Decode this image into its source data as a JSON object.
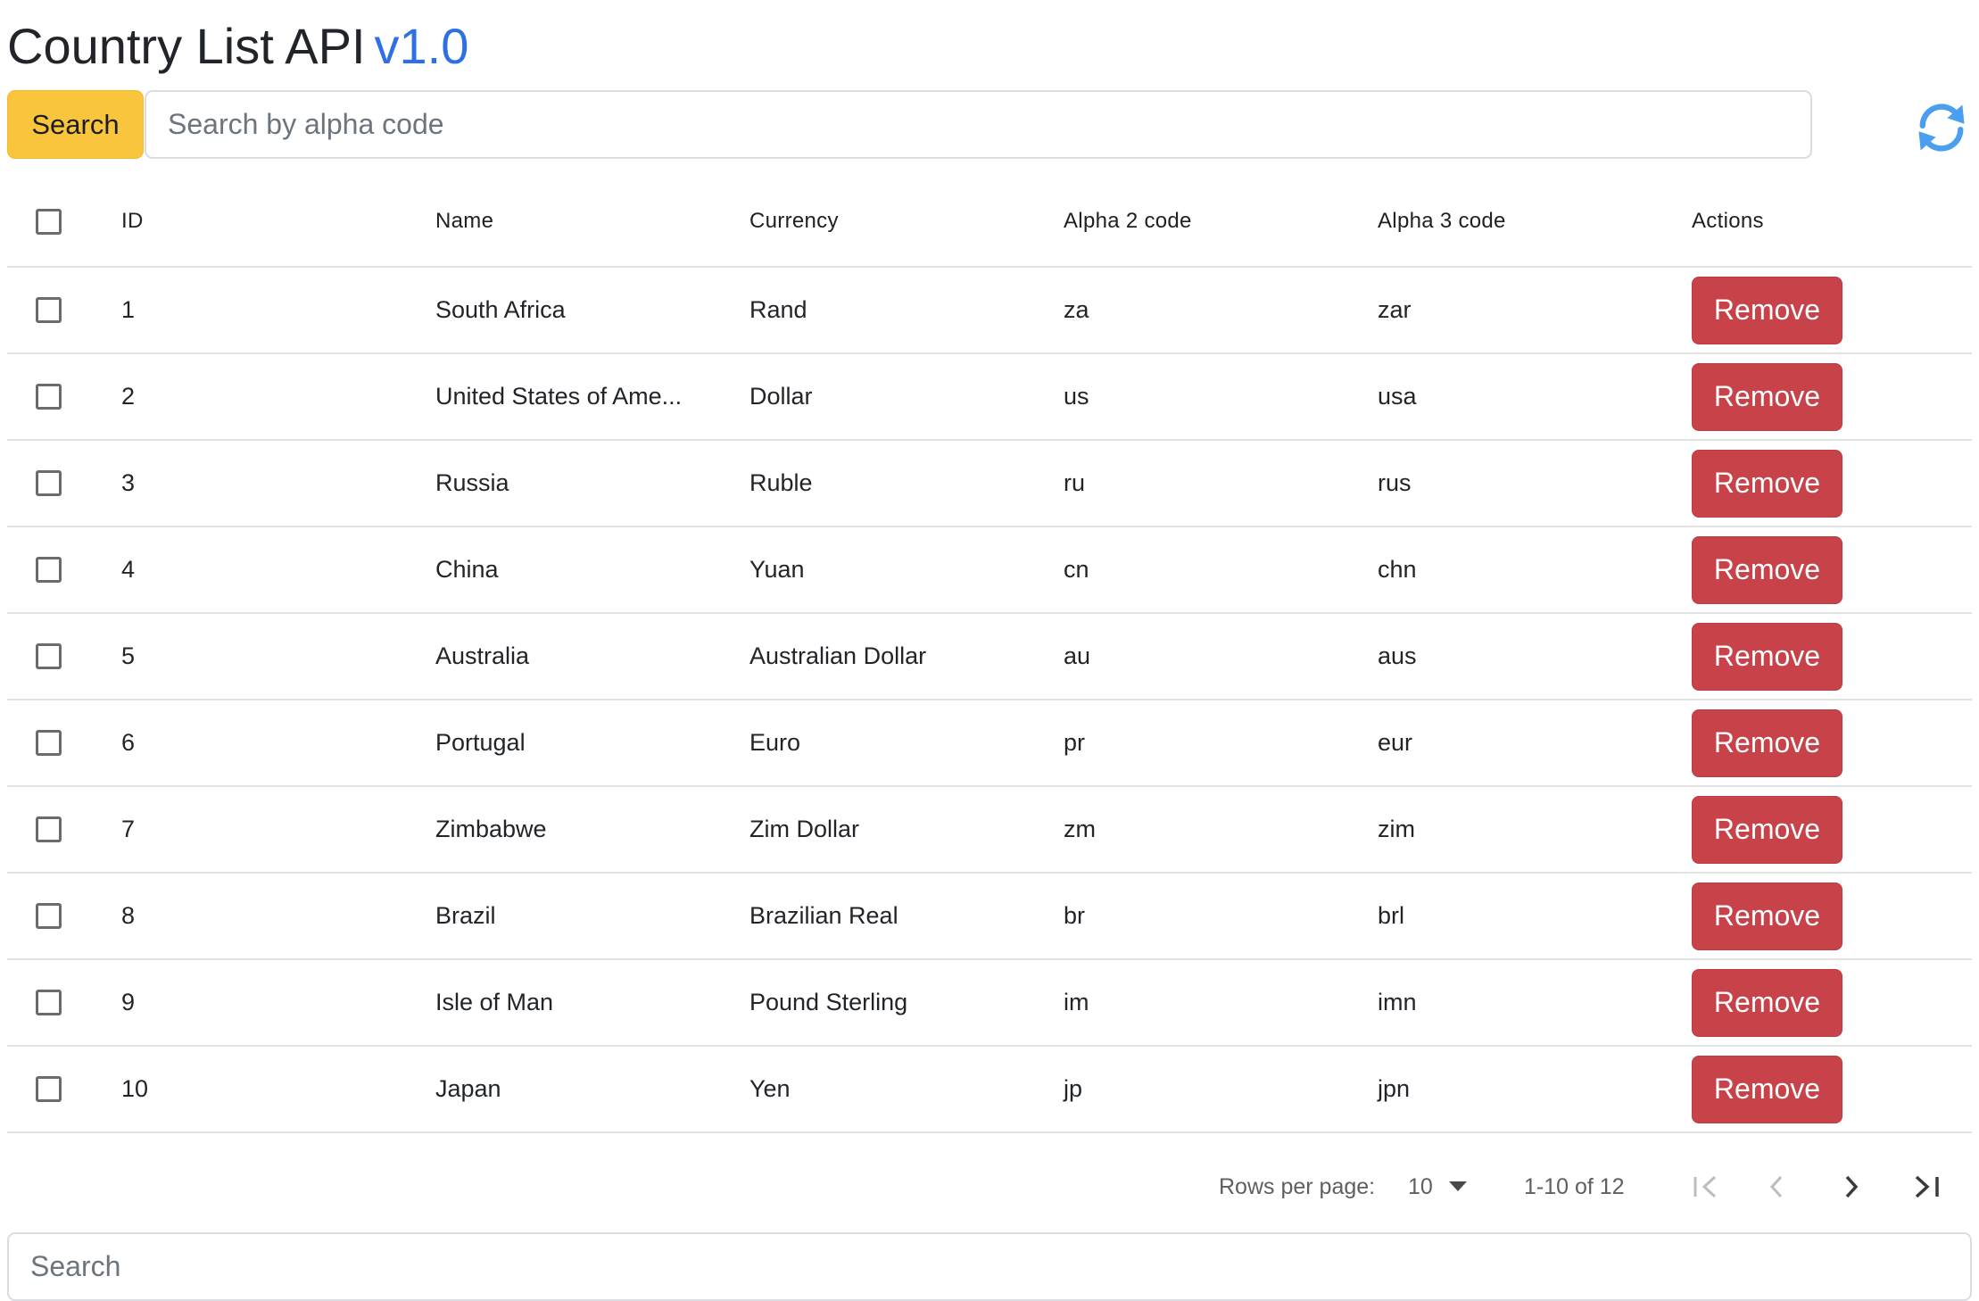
{
  "header": {
    "title": "Country List API",
    "version": "v1.0"
  },
  "search": {
    "button_label": "Search",
    "placeholder": "Search by alpha code",
    "value": ""
  },
  "table": {
    "columns": {
      "id": "ID",
      "name": "Name",
      "currency": "Currency",
      "alpha2": "Alpha 2 code",
      "alpha3": "Alpha 3 code",
      "actions": "Actions"
    },
    "rows": [
      {
        "id": "1",
        "name": "South Africa",
        "currency": "Rand",
        "alpha2": "za",
        "alpha3": "zar",
        "action": "Remove"
      },
      {
        "id": "2",
        "name": "United States of Ame...",
        "currency": "Dollar",
        "alpha2": "us",
        "alpha3": "usa",
        "action": "Remove"
      },
      {
        "id": "3",
        "name": "Russia",
        "currency": "Ruble",
        "alpha2": "ru",
        "alpha3": "rus",
        "action": "Remove"
      },
      {
        "id": "4",
        "name": "China",
        "currency": "Yuan",
        "alpha2": "cn",
        "alpha3": "chn",
        "action": "Remove"
      },
      {
        "id": "5",
        "name": "Australia",
        "currency": "Australian Dollar",
        "alpha2": "au",
        "alpha3": "aus",
        "action": "Remove"
      },
      {
        "id": "6",
        "name": "Portugal",
        "currency": "Euro",
        "alpha2": "pr",
        "alpha3": "eur",
        "action": "Remove"
      },
      {
        "id": "7",
        "name": "Zimbabwe",
        "currency": "Zim Dollar",
        "alpha2": "zm",
        "alpha3": "zim",
        "action": "Remove"
      },
      {
        "id": "8",
        "name": "Brazil",
        "currency": "Brazilian Real",
        "alpha2": "br",
        "alpha3": "brl",
        "action": "Remove"
      },
      {
        "id": "9",
        "name": "Isle of Man",
        "currency": "Pound Sterling",
        "alpha2": "im",
        "alpha3": "imn",
        "action": "Remove"
      },
      {
        "id": "10",
        "name": "Japan",
        "currency": "Yen",
        "alpha2": "jp",
        "alpha3": "jpn",
        "action": "Remove"
      }
    ]
  },
  "pagination": {
    "rows_per_page_label": "Rows per page:",
    "rows_per_page_value": "10",
    "range_text": "1-10 of 12"
  },
  "bottom_search": {
    "placeholder": "Search",
    "value": ""
  },
  "icons": {
    "refresh": "refresh-icon",
    "first": "first-page-icon",
    "prev": "chevron-left-icon",
    "next": "chevron-right-icon",
    "last": "last-page-icon",
    "caret": "caret-down-icon"
  },
  "colors": {
    "search_button": "#f8c53c",
    "remove_button": "#c8424a",
    "version": "#2f6fe4",
    "refresh_icon": "#4a9ff0"
  }
}
